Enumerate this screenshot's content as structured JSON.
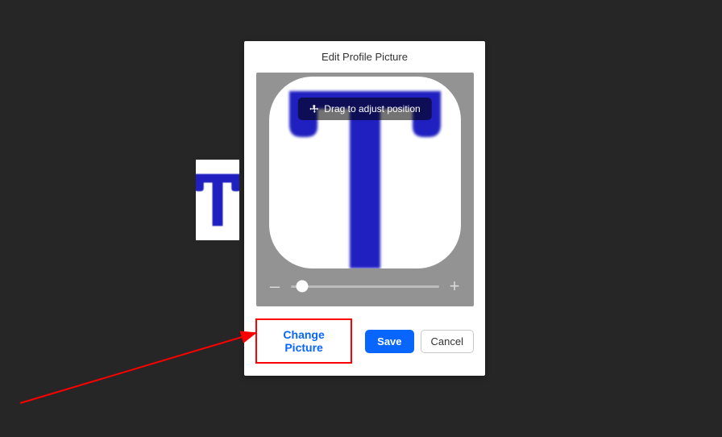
{
  "modal": {
    "title": "Edit Profile Picture",
    "drag_hint": "Drag to adjust position",
    "change_label": "Change Picture",
    "save_label": "Save",
    "cancel_label": "Cancel",
    "zoom_minus": "–",
    "zoom_plus": "+"
  },
  "colors": {
    "accent": "#0866ff",
    "annotation": "#ff0000"
  }
}
